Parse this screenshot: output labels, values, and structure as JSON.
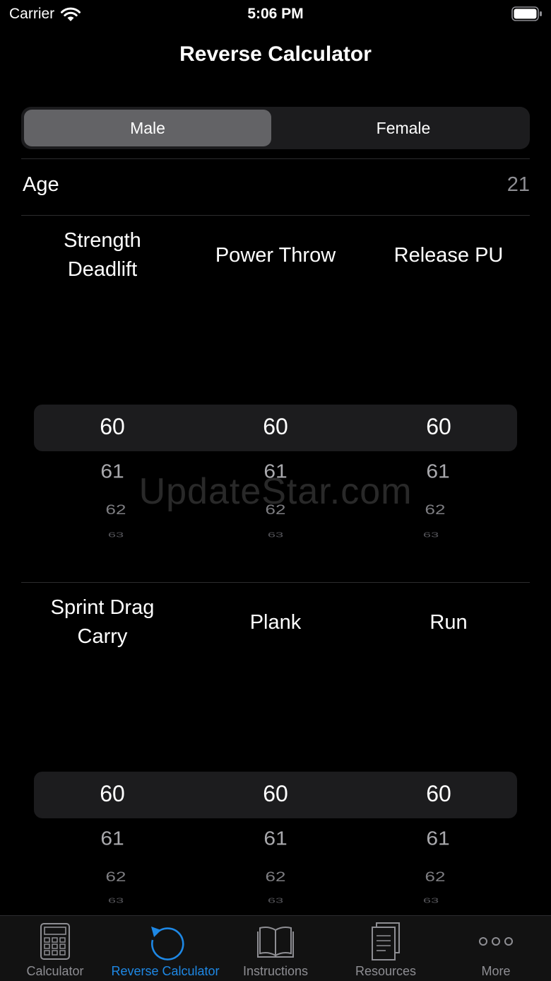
{
  "status_bar": {
    "carrier": "Carrier",
    "time": "5:06 PM"
  },
  "nav": {
    "title": "Reverse Calculator"
  },
  "gender": {
    "options": [
      "Male",
      "Female"
    ],
    "selected": "Male"
  },
  "age": {
    "label": "Age",
    "value": "21"
  },
  "section1": {
    "headers": [
      {
        "line1": "Strength",
        "line2": "Deadlift"
      },
      {
        "line1": "Power Throw",
        "line2": ""
      },
      {
        "line1": "Release PU",
        "line2": ""
      }
    ],
    "pickers": [
      {
        "selected": "60",
        "next": [
          "61",
          "62",
          "63"
        ]
      },
      {
        "selected": "60",
        "next": [
          "61",
          "62",
          "63"
        ]
      },
      {
        "selected": "60",
        "next": [
          "61",
          "62",
          "63"
        ]
      }
    ]
  },
  "section2": {
    "headers": [
      {
        "line1": "Sprint Drag",
        "line2": "Carry"
      },
      {
        "line1": "Plank",
        "line2": ""
      },
      {
        "line1": "Run",
        "line2": ""
      }
    ],
    "pickers": [
      {
        "selected": "60",
        "next": [
          "61",
          "62",
          "63"
        ]
      },
      {
        "selected": "60",
        "next": [
          "61",
          "62",
          "63"
        ]
      },
      {
        "selected": "60",
        "next": [
          "61",
          "62",
          "63"
        ]
      }
    ]
  },
  "watermark": "UpdateStar.com",
  "tabs": [
    {
      "label": "Calculator",
      "icon": "calculator-icon"
    },
    {
      "label": "Reverse Calculator",
      "icon": "reverse-calculator-icon",
      "active": true
    },
    {
      "label": "Instructions",
      "icon": "book-icon"
    },
    {
      "label": "Resources",
      "icon": "document-icon"
    },
    {
      "label": "More",
      "icon": "more-icon"
    }
  ],
  "colors": {
    "accent": "#1e88e5",
    "background": "#000000",
    "selected_segment": "#636366"
  }
}
